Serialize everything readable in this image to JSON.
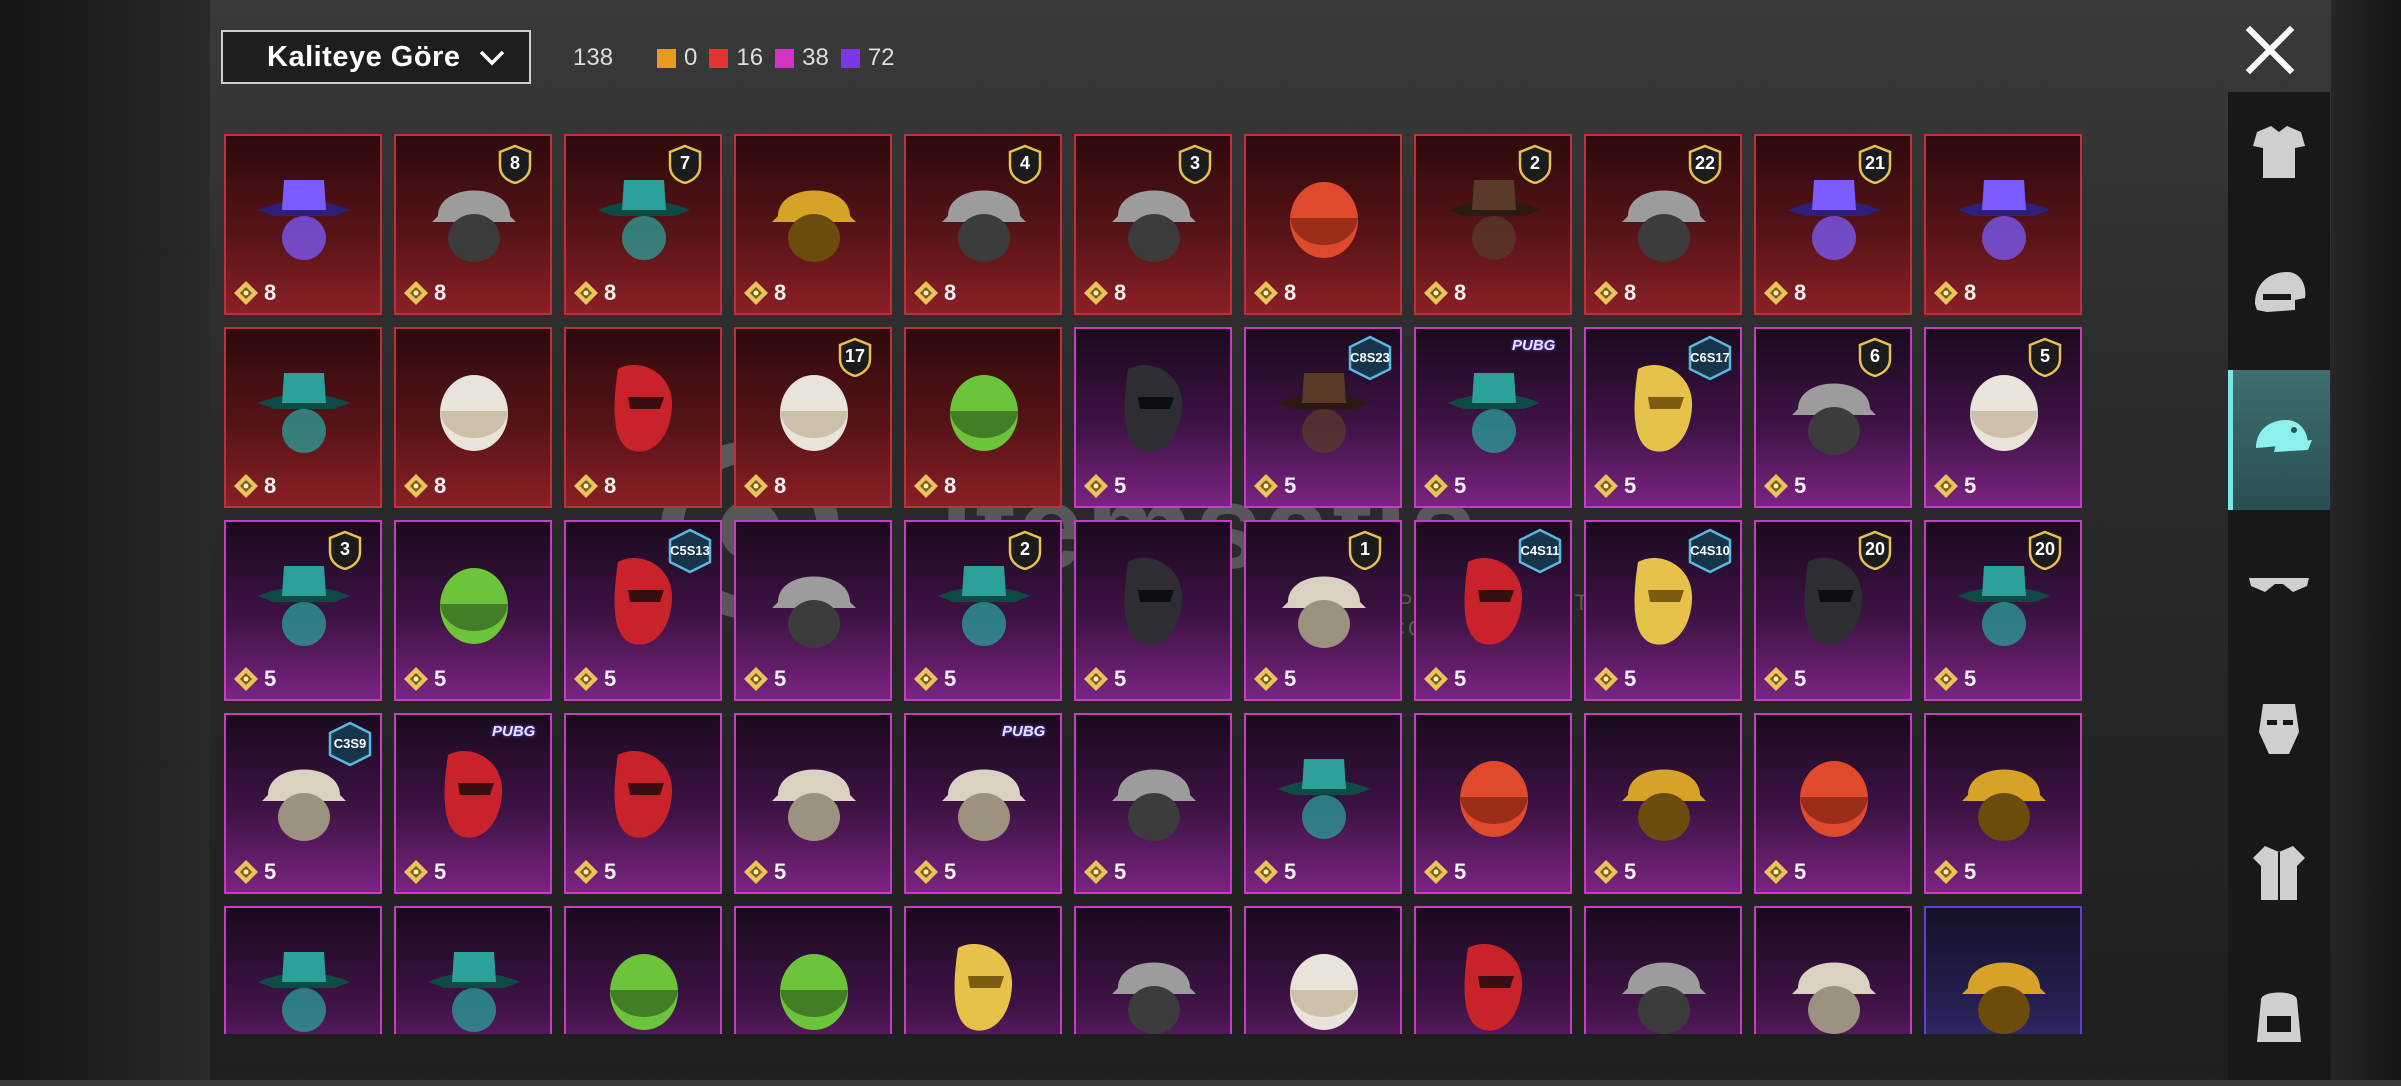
{
  "sort": {
    "label": "Kaliteye Göre"
  },
  "counts": {
    "total": "138",
    "quality": [
      {
        "color": "#e79a1e",
        "value": "0"
      },
      {
        "color": "#e53232",
        "value": "16"
      },
      {
        "color": "#d431c6",
        "value": "38"
      },
      {
        "color": "#7a35e6",
        "value": "72"
      }
    ]
  },
  "watermark": {
    "text": "itemsatis",
    "sub": "APP / SATIN / ITEM / E-PIN .COM"
  },
  "sidebar": {
    "categories": [
      {
        "name": "outfit-set",
        "icon": "outfit-icon",
        "active": false
      },
      {
        "name": "helmet",
        "icon": "helmet-icon",
        "active": false
      },
      {
        "name": "hat",
        "icon": "cap-icon",
        "active": true
      },
      {
        "name": "glasses",
        "icon": "glasses-icon",
        "active": false
      },
      {
        "name": "face",
        "icon": "mask-icon",
        "active": false
      },
      {
        "name": "top",
        "icon": "shirt-icon",
        "active": false
      },
      {
        "name": "backpack",
        "icon": "backpack-icon",
        "active": false
      }
    ]
  },
  "items": [
    {
      "q": "red",
      "cost": "8",
      "badge": "",
      "icon": "white-cowboy-hat"
    },
    {
      "q": "red",
      "cost": "8",
      "badge": "8",
      "icon": "blonde-hair"
    },
    {
      "q": "red",
      "cost": "8",
      "badge": "7",
      "icon": "white-long-hair"
    },
    {
      "q": "red",
      "cost": "8",
      "badge": "",
      "icon": "red-helmet"
    },
    {
      "q": "red",
      "cost": "8",
      "badge": "4",
      "icon": "snowman-top-hat"
    },
    {
      "q": "red",
      "cost": "8",
      "badge": "3",
      "icon": "green-curly-hair-mask"
    },
    {
      "q": "red",
      "cost": "8",
      "badge": "",
      "icon": "teal-spiked-helm"
    },
    {
      "q": "red",
      "cost": "8",
      "badge": "2",
      "icon": "blue-bucket-hat"
    },
    {
      "q": "red",
      "cost": "8",
      "badge": "22",
      "icon": "gold-mask"
    },
    {
      "q": "red",
      "cost": "8",
      "badge": "21",
      "icon": "silver-hair-mask"
    },
    {
      "q": "red",
      "cost": "8",
      "badge": "",
      "icon": "red-horned-mask"
    },
    {
      "q": "red",
      "cost": "8",
      "badge": "",
      "icon": "red-visor-helmet"
    },
    {
      "q": "red",
      "cost": "8",
      "badge": "",
      "icon": "dark-brown-hair"
    },
    {
      "q": "red",
      "cost": "8",
      "badge": "",
      "icon": "black-horned-helmet"
    },
    {
      "q": "red",
      "cost": "8",
      "badge": "17",
      "icon": "gold-knight-helmet"
    },
    {
      "q": "red",
      "cost": "8",
      "badge": "",
      "icon": "gold-mech-helmet"
    },
    {
      "q": "purple",
      "cost": "5",
      "badge": "",
      "icon": "long-brown-hair"
    },
    {
      "q": "purple",
      "cost": "5",
      "badge": "C8S23",
      "icon": "cat-ear-headphones"
    },
    {
      "q": "purple",
      "cost": "5",
      "badge": "PUBG",
      "icon": "cap-goggles"
    },
    {
      "q": "purple",
      "cost": "5",
      "badge": "C6S17",
      "icon": "yellow-visor"
    },
    {
      "q": "purple",
      "cost": "5",
      "badge": "6",
      "icon": "black-gold-helm"
    },
    {
      "q": "purple",
      "cost": "5",
      "badge": "5",
      "icon": "bow-pigtails"
    },
    {
      "q": "purple",
      "cost": "5",
      "badge": "3",
      "icon": "jester-hat"
    },
    {
      "q": "purple",
      "cost": "5",
      "badge": "",
      "icon": "long-dark-hair"
    },
    {
      "q": "purple",
      "cost": "5",
      "badge": "C5S13",
      "icon": "green-cat-hat"
    },
    {
      "q": "purple",
      "cost": "5",
      "badge": "",
      "icon": "straw-hat"
    },
    {
      "q": "purple",
      "cost": "5",
      "badge": "2",
      "icon": "blonde-bandana-hair"
    },
    {
      "q": "purple",
      "cost": "5",
      "badge": "",
      "icon": "potato-head"
    },
    {
      "q": "purple",
      "cost": "5",
      "badge": "1",
      "icon": "white-blue-hair"
    },
    {
      "q": "purple",
      "cost": "5",
      "badge": "C4S11",
      "icon": "red-cap"
    },
    {
      "q": "purple",
      "cost": "5",
      "badge": "C4S10",
      "icon": "green-hood"
    },
    {
      "q": "purple",
      "cost": "5",
      "badge": "20",
      "icon": "feather-hat-hair"
    },
    {
      "q": "purple",
      "cost": "5",
      "badge": "20",
      "icon": "black-gold-mask"
    },
    {
      "q": "purple",
      "cost": "5",
      "badge": "C3S9",
      "icon": "purple-bandana-hair"
    },
    {
      "q": "purple",
      "cost": "5",
      "badge": "PUBG",
      "icon": "octopus-mask"
    },
    {
      "q": "purple",
      "cost": "5",
      "badge": "",
      "icon": "pink-visor-helmet"
    },
    {
      "q": "purple",
      "cost": "5",
      "badge": "",
      "icon": "yellow-bucket-hat"
    },
    {
      "q": "purple",
      "cost": "5",
      "badge": "PUBG",
      "icon": "gas-mask-beanie"
    },
    {
      "q": "purple",
      "cost": "5",
      "badge": "",
      "icon": "yellow-space-helmet"
    },
    {
      "q": "purple",
      "cost": "5",
      "badge": "",
      "icon": "mustard-beanie"
    },
    {
      "q": "purple",
      "cost": "5",
      "badge": "",
      "icon": "cowboy-hat-hair"
    },
    {
      "q": "purple",
      "cost": "5",
      "badge": "",
      "icon": "black-top-hat"
    },
    {
      "q": "purple",
      "cost": "5",
      "badge": "",
      "icon": "ribbon-bow-hair"
    },
    {
      "q": "purple",
      "cost": "5",
      "badge": "",
      "icon": "black-bandana"
    },
    {
      "q": "purple",
      "cost": "",
      "badge": "",
      "icon": "wolf-mask"
    },
    {
      "q": "purple",
      "cost": "",
      "badge": "",
      "icon": "bunny-space-helmet"
    },
    {
      "q": "purple",
      "cost": "",
      "badge": "",
      "icon": "goggles-helmet"
    },
    {
      "q": "purple",
      "cost": "",
      "badge": "",
      "icon": "dreadlock-mask"
    },
    {
      "q": "purple",
      "cost": "",
      "badge": "",
      "icon": "frog-hat"
    },
    {
      "q": "purple",
      "cost": "",
      "badge": "",
      "icon": "cap-red-hair"
    },
    {
      "q": "purple",
      "cost": "",
      "badge": "",
      "icon": "gas-mask"
    },
    {
      "q": "purple",
      "cost": "",
      "badge": "",
      "icon": "black-beanie"
    },
    {
      "q": "purple",
      "cost": "",
      "badge": "",
      "icon": "headband"
    },
    {
      "q": "purple",
      "cost": "",
      "badge": "",
      "icon": "small-hair-clip"
    },
    {
      "q": "violet",
      "cost": "",
      "badge": "",
      "icon": "grey-long-hair"
    }
  ]
}
